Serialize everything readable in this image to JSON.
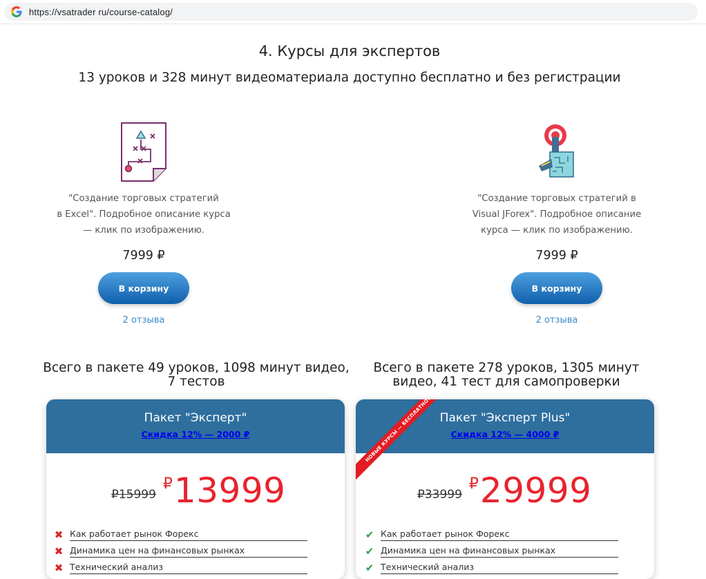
{
  "browser": {
    "url": "https://vsatrader ru/course-catalog/"
  },
  "section": {
    "title": "4. Курсы для экспертов",
    "subtitle": "13 уроков и 328 минут видеоматериала доступно бесплатно и без регистрации"
  },
  "courses": [
    {
      "desc_line1": "\"Создание торговых стратегий",
      "desc_line2": "в Excel\". Подробное описание курса",
      "desc_line3": "— клик по изображению.",
      "price": "7999 ₽",
      "cart_label": "В корзину",
      "reviews": "2 отзыва"
    },
    {
      "desc_line1": "\"Создание торговых стратегий в",
      "desc_line2": "Visual JForex\". Подробное описание",
      "desc_line3": "курса — клик по изображению.",
      "price": "7999 ₽",
      "cart_label": "В корзину",
      "reviews": "2 отзыва"
    }
  ],
  "packages": [
    {
      "total_line1": "Всего в пакете 49 уроков, 1098 минут видео,",
      "total_line2": "7 тестов",
      "name": "Пакет \"Эксперт\"",
      "discount": "Скидка 12% — 2000 ₽",
      "old_price": "₽15999",
      "currency": "₽",
      "new_price": "13999",
      "features": [
        {
          "text": "Как работает рынок Форекс",
          "included": false
        },
        {
          "text": "Динамика цен на финансовых рынках",
          "included": false
        },
        {
          "text": "Технический анализ",
          "included": false
        }
      ]
    },
    {
      "total_line1": "Всего в пакете 278 уроков, 1305 минут",
      "total_line2": "видео, 41 тест для самопроверки",
      "name": "Пакет \"Эксперт Plus\"",
      "discount": "Скидка 12% — 4000 ₽",
      "ribbon": "НОВЫЕ КУРСЫ — БЕСПЛАТНО!",
      "old_price": "₽33999",
      "currency": "₽",
      "new_price": "29999",
      "features": [
        {
          "text": "Как работает рынок Форекс",
          "included": true
        },
        {
          "text": "Динамика цен на финансовых рынках",
          "included": true
        },
        {
          "text": "Технический анализ",
          "included": true
        }
      ]
    }
  ],
  "colors": {
    "accent_blue": "#2e6f9e",
    "button_blue": "#1a6fbf",
    "price_red": "#e8232e",
    "check_green": "#2e9e4f",
    "cross_red": "#d9262c"
  }
}
